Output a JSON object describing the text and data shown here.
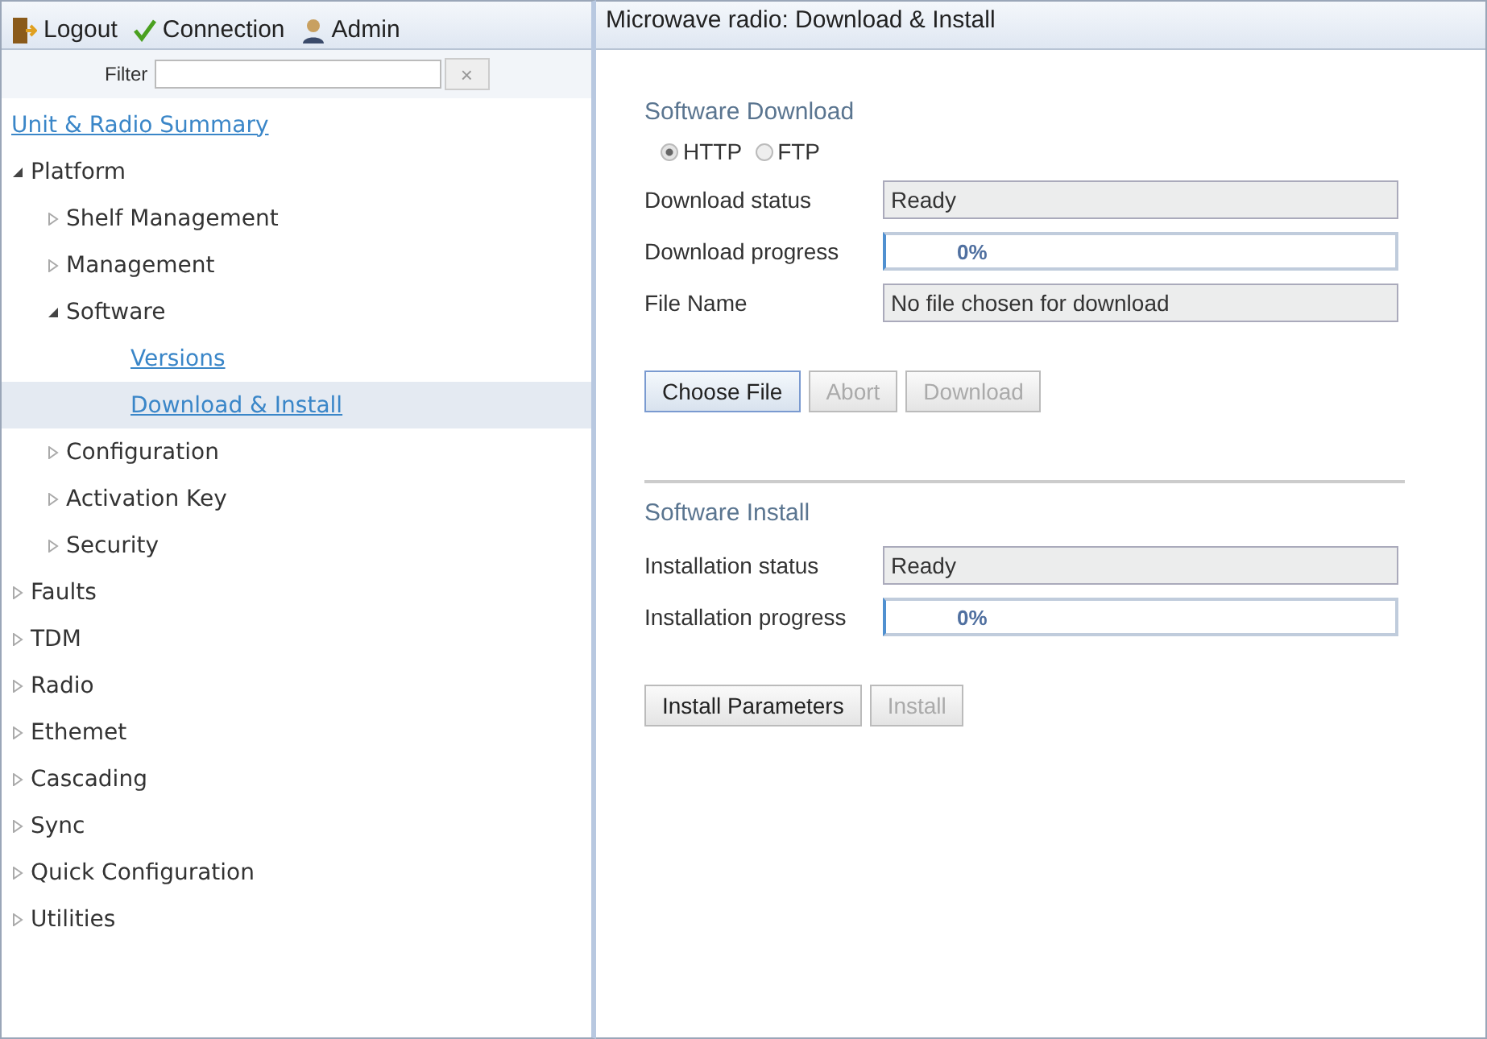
{
  "toolbar": {
    "items": [
      {
        "kind": "logout",
        "label": "Logout"
      },
      {
        "kind": "connection",
        "label": "Connection"
      },
      {
        "kind": "admin",
        "label": "Admin"
      }
    ]
  },
  "filter": {
    "label": "Filter",
    "clear": "×"
  },
  "tree": [
    {
      "label": "Unit & Radio Summary",
      "kind": "link",
      "selected": false
    },
    {
      "label": "Platform",
      "kind": "node",
      "expanded": true,
      "children": [
        {
          "label": "Shelf Management",
          "kind": "node",
          "expanded": false
        },
        {
          "label": "Management",
          "kind": "node",
          "expanded": false
        },
        {
          "label": "Software",
          "kind": "node",
          "expanded": true,
          "children": [
            {
              "label": "Versions",
              "kind": "link",
              "selected": false
            },
            {
              "label": "Download & Install",
              "kind": "link",
              "selected": true
            }
          ]
        },
        {
          "label": "Configuration",
          "kind": "node",
          "expanded": false
        },
        {
          "label": "Activation Key",
          "kind": "node",
          "expanded": false
        },
        {
          "label": "Security",
          "kind": "node",
          "expanded": false
        }
      ]
    },
    {
      "label": "Faults",
      "kind": "node",
      "expanded": false
    },
    {
      "label": "TDM",
      "kind": "node",
      "expanded": false
    },
    {
      "label": "Radio",
      "kind": "node",
      "expanded": false
    },
    {
      "label": "Ethemet",
      "kind": "node",
      "expanded": false
    },
    {
      "label": "Cascading",
      "kind": "node",
      "expanded": false
    },
    {
      "label": "Sync",
      "kind": "node",
      "expanded": false
    },
    {
      "label": "Quick Configuration",
      "kind": "node",
      "expanded": false
    },
    {
      "label": "Utilities",
      "kind": "node",
      "expanded": false
    }
  ],
  "page": {
    "title": "Microwave radio: Download & Install",
    "sections": [
      {
        "heading": "Software Download",
        "radios": [
          {
            "label": "HTTP",
            "selected": true
          },
          {
            "label": "FTP",
            "selected": false
          }
        ],
        "fields": [
          {
            "kind": "text",
            "label": "Download status",
            "value": "Ready"
          },
          {
            "kind": "progress",
            "label": "Download progress",
            "value": "0%",
            "level": 0
          },
          {
            "kind": "text",
            "label": "File Name",
            "value": "No file chosen for download"
          }
        ],
        "buttons": [
          {
            "label": "Choose File",
            "disabled": false,
            "focused": true
          },
          {
            "label": "Abort",
            "disabled": true,
            "focused": false
          },
          {
            "label": "Download",
            "disabled": true,
            "focused": false
          }
        ]
      },
      {
        "heading": "Software Install",
        "fields": [
          {
            "kind": "text",
            "label": "Installation status",
            "value": "Ready"
          },
          {
            "kind": "progress",
            "label": "Installation progress",
            "value": "0%",
            "level": 0
          }
        ],
        "buttons": [
          {
            "label": "Install Parameters",
            "disabled": false,
            "focused": false
          },
          {
            "label": "Install",
            "disabled": true,
            "focused": false
          }
        ]
      }
    ]
  }
}
